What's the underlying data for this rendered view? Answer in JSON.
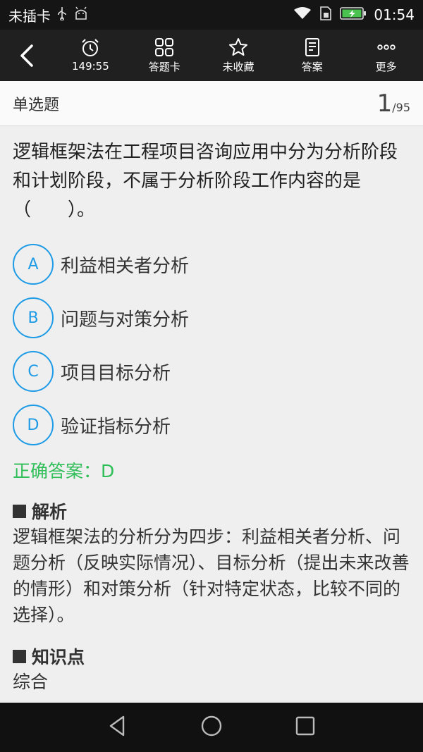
{
  "status_bar": {
    "carrier": "未插卡",
    "time": "01:54",
    "icons": [
      "usb-icon",
      "android-debug-icon",
      "wifi-icon",
      "sim-icon",
      "battery-charging-icon"
    ]
  },
  "toolbar": {
    "back_icon": "back-arrow-icon",
    "items": [
      {
        "label": "149:55",
        "icon": "alarm-clock-icon"
      },
      {
        "label": "答题卡",
        "icon": "grid-icon"
      },
      {
        "label": "未收藏",
        "icon": "star-outline-icon"
      },
      {
        "label": "答案",
        "icon": "document-icon"
      },
      {
        "label": "更多",
        "icon": "more-dots-icon"
      }
    ]
  },
  "question": {
    "type": "单选题",
    "current": "1",
    "total": "/95",
    "stem": "逻辑框架法在工程项目咨询应用中分为分析阶段和计划阶段，不属于分析阶段工作内容的是（　　）。",
    "options": [
      {
        "letter": "A",
        "text": "利益相关者分析"
      },
      {
        "letter": "B",
        "text": "问题与对策分析"
      },
      {
        "letter": "C",
        "text": "项目目标分析"
      },
      {
        "letter": "D",
        "text": "验证指标分析"
      }
    ],
    "answer": "正确答案：D",
    "analysis_title": "解析",
    "analysis": "逻辑框架法的分析分为四步：利益相关者分析、问题分析（反映实际情况）、目标分析（提出未来改善的情形）和对策分析（针对特定状态，比较不同的选择）。",
    "knowledge_title": "知识点",
    "knowledge": "综合"
  },
  "colors": {
    "accent": "#1e9be6",
    "answer_green": "#2fbe58",
    "toolbar_bg": "#202020"
  }
}
